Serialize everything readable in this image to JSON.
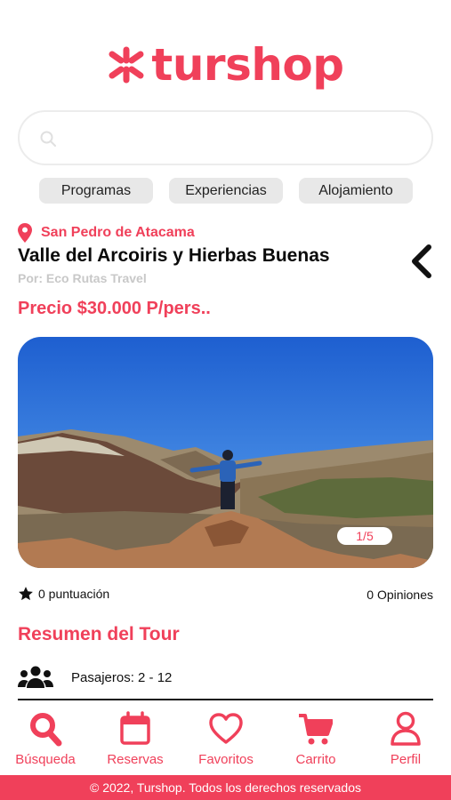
{
  "brand": {
    "name": "turshop",
    "color": "#f0405a",
    "logo_icon": "asterisk-logo-icon"
  },
  "search": {
    "placeholder": "",
    "value": ""
  },
  "categories": [
    "Programas",
    "Experiencias",
    "Alojamiento"
  ],
  "tour": {
    "location": "San Pedro de Atacama",
    "title": "Valle del Arcoiris y Hierbas Buenas",
    "operator": "Por: Eco Rutas Travel",
    "price": "Precio $30.000 P/pers..",
    "gallery_position": "1/5"
  },
  "stats": {
    "rating": "0 puntuación",
    "opinions": "0 Opiniones"
  },
  "summary": {
    "heading": "Resumen del Tour",
    "passengers": "Pasajeros: 2 - 12"
  },
  "bottom_nav": [
    {
      "label": "Búsqueda",
      "icon": "search-icon"
    },
    {
      "label": "Reservas",
      "icon": "calendar-icon"
    },
    {
      "label": "Favoritos",
      "icon": "heart-icon"
    },
    {
      "label": "Carrito",
      "icon": "cart-icon"
    },
    {
      "label": "Perfil",
      "icon": "user-icon"
    }
  ],
  "footer": {
    "text": "© 2022, Turshop. Todos los derechos reservados"
  }
}
